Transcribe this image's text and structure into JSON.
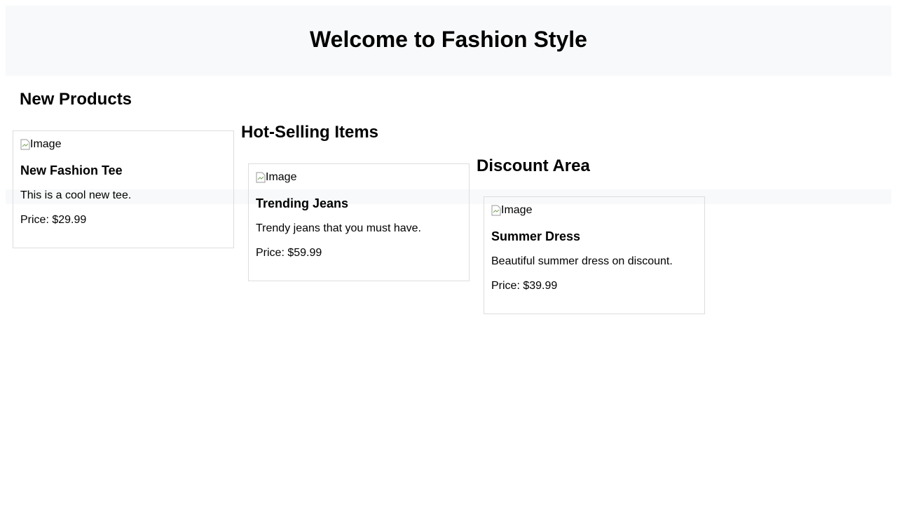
{
  "header": {
    "title": "Welcome to Fashion Style"
  },
  "sections": [
    {
      "title": "New Products",
      "product": {
        "image_alt": "Image",
        "name": "New Fashion Tee",
        "description": "This is a cool new tee.",
        "price": "Price: $29.99"
      }
    },
    {
      "title": "Hot-Selling Items",
      "product": {
        "image_alt": "Image",
        "name": "Trending Jeans",
        "description": "Trendy jeans that you must have.",
        "price": "Price: $59.99"
      }
    },
    {
      "title": "Discount Area",
      "product": {
        "image_alt": "Image",
        "name": "Summer Dress",
        "description": "Beautiful summer dress on discount.",
        "price": "Price: $39.99"
      }
    }
  ],
  "colors": {
    "header_background": "#f8f9fa",
    "card_border": "#dddddd",
    "text": "#000000"
  },
  "icons": {
    "image_placeholder": "broken-image-icon"
  }
}
